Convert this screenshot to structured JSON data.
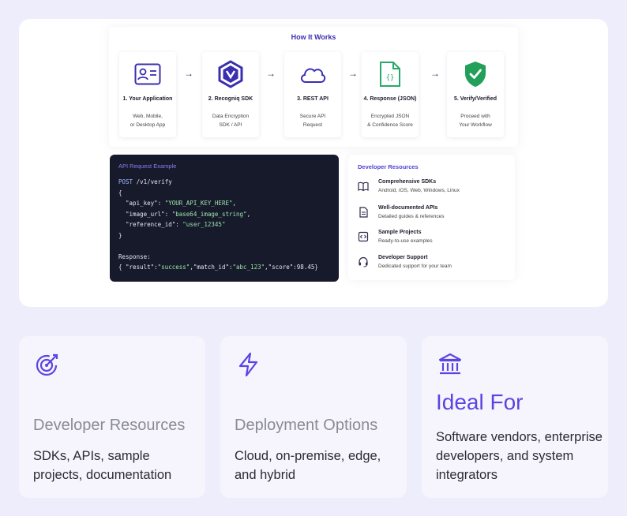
{
  "flow": {
    "title": "How It Works",
    "steps": [
      {
        "title": "1. Your Application",
        "desc1": "Web, Mobile,",
        "desc2": "or Desktop App",
        "icon": "id-card-icon"
      },
      {
        "title": "2. Recogniq SDK",
        "desc1": "Data Encryption",
        "desc2": "SDK / API",
        "icon": "sdk-hexagon-icon"
      },
      {
        "title": "3. REST API",
        "desc1": "Secure API",
        "desc2": "Request",
        "icon": "cloud-icon"
      },
      {
        "title": "4. Response (JSON)",
        "desc1": "Encrypted JSON",
        "desc2": "& Confidence Score",
        "icon": "json-file-icon"
      },
      {
        "title": "5. Verify/Verified",
        "desc1": "Proceed with",
        "desc2": "Your Workflow",
        "icon": "shield-check-icon"
      }
    ],
    "arrow": "→"
  },
  "code": {
    "title": "API Request Example",
    "method": "POST",
    "path": " /v1/verify",
    "open": "{",
    "k1": "  \"api_key\": ",
    "v1": "\"YOUR_API_KEY_HERE\"",
    "k2": "  \"image_url\": ",
    "v2": "\"base64_image_string\"",
    "k3": "  \"reference_id\": ",
    "v3": "\"user_12345\"",
    "close": "}",
    "response_label": "Response:",
    "r_open": "{ \"result\":",
    "r_v1": "\"success\"",
    "r_k2": ",\"match_id\":",
    "r_v2": "\"abc_123\"",
    "r_k3": ",\"score\":98.45}",
    "comma": ","
  },
  "resources": {
    "title": "Developer Resources",
    "items": [
      {
        "title": "Comprehensive SDKs",
        "desc": "Android, iOS, Web, Windows, Linux",
        "icon": "book-icon"
      },
      {
        "title": "Well-documented APIs",
        "desc": "Detailed guides & references",
        "icon": "document-icon"
      },
      {
        "title": "Sample Projects",
        "desc": "Ready-to-use examples",
        "icon": "code-file-icon"
      },
      {
        "title": "Developer Support",
        "desc": "Dedicated support for your team",
        "icon": "headset-icon"
      }
    ]
  },
  "cards": [
    {
      "title": "Developer Resources",
      "text": "SDKs, APIs, sample projects, documentation",
      "icon": "target-icon"
    },
    {
      "title": "Deployment Options",
      "text": "Cloud, on-premise, edge, and hybrid",
      "icon": "lightning-icon"
    },
    {
      "title": "Ideal For",
      "text": " Software vendors, enterprise developers, and system integrators",
      "icon": "bank-icon"
    }
  ],
  "colors": {
    "accent": "#5b45e0",
    "code_bg": "#161a2b",
    "page_bg": "#eeedfb"
  }
}
